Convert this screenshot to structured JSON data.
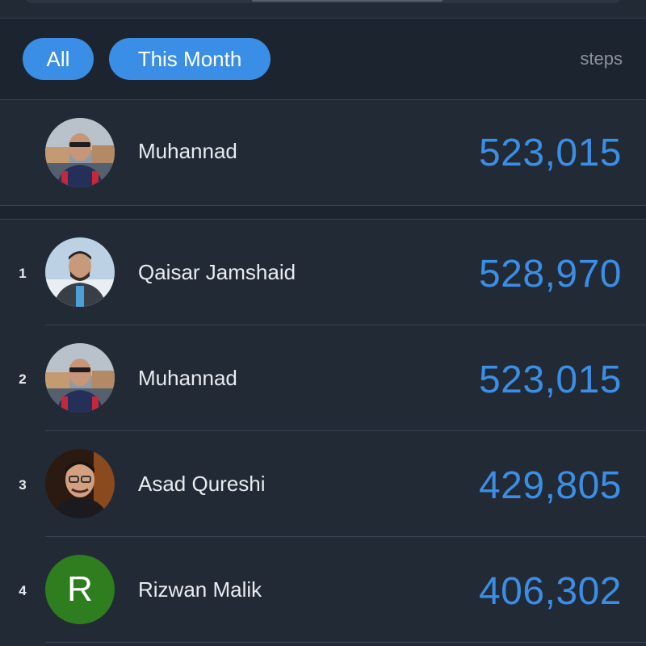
{
  "filters": {
    "all_label": "All",
    "month_label": "This Month",
    "unit_label": "steps"
  },
  "current_user": {
    "name": "Muhannad",
    "steps": "523,015",
    "avatar": "photo-man-sunglasses"
  },
  "leaderboard": [
    {
      "rank": "1",
      "name": "Qaisar Jamshaid",
      "steps": "528,970",
      "avatar": "photo-man-beard"
    },
    {
      "rank": "2",
      "name": "Muhannad",
      "steps": "523,015",
      "avatar": "photo-man-sunglasses"
    },
    {
      "rank": "3",
      "name": "Asad Qureshi",
      "steps": "429,805",
      "avatar": "photo-man-glasses"
    },
    {
      "rank": "4",
      "name": "Rizwan Malik",
      "steps": "406,302",
      "avatar": "letter-avatar",
      "initial": "R"
    }
  ],
  "colors": {
    "accent": "#3a8ee6",
    "background": "#222a35",
    "bar_background": "#1c2430",
    "letter_avatar": "#2e7d1f"
  }
}
